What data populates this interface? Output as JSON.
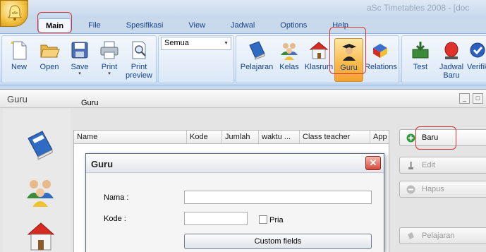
{
  "app": {
    "title": "aSc Timetables 2008 - [doc",
    "orb_icon": "bell-icon"
  },
  "tabs": [
    {
      "label": "Main",
      "active": true
    },
    {
      "label": "File"
    },
    {
      "label": "Spesifikasi"
    },
    {
      "label": "View"
    },
    {
      "label": "Jadwal"
    },
    {
      "label": "Options"
    },
    {
      "label": "Help"
    }
  ],
  "ribbon": {
    "file_buttons": [
      {
        "label": "New",
        "icon": "new-document-icon"
      },
      {
        "label": "Open",
        "icon": "open-folder-icon"
      },
      {
        "label": "Save",
        "icon": "save-disk-icon",
        "dropdown": "▾"
      },
      {
        "label": "Print",
        "icon": "printer-icon",
        "dropdown": "▾"
      },
      {
        "label": "Print\npreview",
        "icon": "print-preview-icon"
      }
    ],
    "filter": {
      "value": "Semua"
    },
    "data_buttons": [
      {
        "label": "Pelajaran",
        "icon": "book-icon"
      },
      {
        "label": "Kelas",
        "icon": "students-icon"
      },
      {
        "label": "Klasrum",
        "icon": "house-icon"
      },
      {
        "label": "Guru",
        "icon": "teacher-icon",
        "selected": true
      },
      {
        "label": "Relations",
        "icon": "shapes-icon"
      }
    ],
    "tool_buttons": [
      {
        "label": "Test",
        "icon": "test-tray-icon"
      },
      {
        "label": "Jadwal\nBaru",
        "icon": "red-light-icon"
      },
      {
        "label": "Verifik",
        "icon": "verify-icon"
      }
    ]
  },
  "child_window": {
    "title": "Guru",
    "list_title": "Guru",
    "columns": [
      "Name",
      "Kode",
      "Jumlah",
      "waktu ...",
      "Class teacher",
      "App"
    ],
    "sidebar_icons": [
      "subject-book-icon",
      "class-students-icon",
      "classroom-house-icon"
    ],
    "actions": [
      {
        "label": "Baru",
        "icon": "plus-circle-icon",
        "enabled": true
      },
      {
        "label": "Edit",
        "icon": "edit-icon",
        "enabled": false
      },
      {
        "label": "Hapus",
        "icon": "minus-circle-icon",
        "enabled": false
      },
      {
        "label": "Pelajaran",
        "icon": "subjects-icon",
        "enabled": false
      }
    ]
  },
  "dialog": {
    "title": "Guru",
    "close_label": "✕",
    "name_label": "Nama :",
    "name_value": "",
    "code_label": "Kode :",
    "code_value": "",
    "pria_label": "Pria",
    "custom_fields_label": "Custom fields"
  },
  "colors": {
    "ribbon_bg": "#d8e6f6",
    "tab_text": "#15428b",
    "selected_button": "#f9b94a",
    "highlight_ring": "#d93030"
  }
}
